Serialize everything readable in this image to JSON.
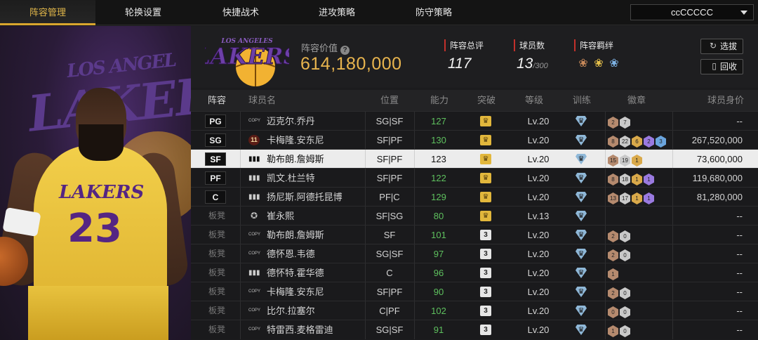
{
  "nav": {
    "tabs": [
      "阵容管理",
      "轮换设置",
      "快捷战术",
      "进攻策略",
      "防守策略"
    ],
    "active_index": 0,
    "dropdown_value": "ccCCCCC"
  },
  "summary": {
    "value_label": "阵容价值",
    "value": "614,180,000",
    "rating_label": "阵容总评",
    "rating": "117",
    "count_label": "球员数",
    "count": "13",
    "count_max": "/300",
    "bond_label": "阵容羁绊",
    "buttons": {
      "select": "选拔",
      "recycle": "回收"
    }
  },
  "jersey": {
    "team": "LAKERS",
    "number": "23"
  },
  "table": {
    "headers": {
      "lineup": "阵容",
      "name": "球员名",
      "position": "位置",
      "ability": "能力",
      "breakthrough": "突破",
      "level": "等级",
      "training": "训练",
      "badges": "徽章",
      "worth": "球员身价"
    },
    "rows": [
      {
        "slot": "PG",
        "card": "COPY",
        "name": "迈克尔.乔丹",
        "pos": "SG|SF",
        "ability": "127",
        "break": "crown",
        "level": "Lv.20",
        "badges": [
          "2",
          "7"
        ],
        "worth": "--"
      },
      {
        "slot": "SG",
        "card": "11",
        "name": "卡梅隆.安东尼",
        "pos": "SF|PF",
        "ability": "130",
        "break": "crown",
        "level": "Lv.20",
        "badges": [
          "8",
          "22",
          "6",
          "2",
          "3"
        ],
        "worth": "267,520,000"
      },
      {
        "slot": "SF",
        "card": "bars",
        "name": "勒布朗.詹姆斯",
        "pos": "SF|PF",
        "ability": "123",
        "break": "crown",
        "level": "Lv.20",
        "badges": [
          "15",
          "19",
          "1"
        ],
        "worth": "73,600,000",
        "selected": true
      },
      {
        "slot": "PF",
        "card": "bars",
        "name": "凯文.杜兰特",
        "pos": "SF|PF",
        "ability": "122",
        "break": "crown",
        "level": "Lv.20",
        "badges": [
          "8",
          "18",
          "1",
          "1"
        ],
        "worth": "119,680,000"
      },
      {
        "slot": "C",
        "card": "bars",
        "name": "扬尼斯.阿德托昆博",
        "pos": "PF|C",
        "ability": "129",
        "break": "crown",
        "level": "Lv.20",
        "badges": [
          "13",
          "17",
          "1",
          "1"
        ],
        "worth": "81,280,000"
      },
      {
        "slot": "板凳",
        "card": "star",
        "name": "崔永熙",
        "pos": "SF|SG",
        "ability": "80",
        "break": "crown",
        "level": "Lv.13",
        "badges": [],
        "worth": "--"
      },
      {
        "slot": "板凳",
        "card": "COPY",
        "name": "勒布朗.詹姆斯",
        "pos": "SF",
        "ability": "101",
        "break": "3",
        "level": "Lv.20",
        "badges": [
          "2",
          "0"
        ],
        "worth": "--"
      },
      {
        "slot": "板凳",
        "card": "COPY",
        "name": "德怀恩.韦德",
        "pos": "SG|SF",
        "ability": "97",
        "break": "3",
        "level": "Lv.20",
        "badges": [
          "2",
          "0"
        ],
        "worth": "--"
      },
      {
        "slot": "板凳",
        "card": "bars",
        "name": "德怀特.霍华德",
        "pos": "C",
        "ability": "96",
        "break": "3",
        "level": "Lv.20",
        "badges": [
          "1"
        ],
        "worth": "--"
      },
      {
        "slot": "板凳",
        "card": "COPY",
        "name": "卡梅隆.安东尼",
        "pos": "SF|PF",
        "ability": "90",
        "break": "3",
        "level": "Lv.20",
        "badges": [
          "2",
          "0"
        ],
        "worth": "--"
      },
      {
        "slot": "板凳",
        "card": "COPY",
        "name": "比尔.拉塞尔",
        "pos": "C|PF",
        "ability": "102",
        "break": "3",
        "level": "Lv.20",
        "badges": [
          "0",
          "0"
        ],
        "worth": "--"
      },
      {
        "slot": "板凳",
        "card": "COPY",
        "name": "特雷西.麦格雷迪",
        "pos": "SG|SF",
        "ability": "91",
        "break": "3",
        "level": "Lv.20",
        "badges": [
          "1",
          "0"
        ],
        "worth": "--"
      }
    ]
  },
  "colors": {
    "accent": "#d9a62e",
    "value": "#e9b54e",
    "ability": "#5ec05e",
    "stat_marker": "#c3302b"
  }
}
